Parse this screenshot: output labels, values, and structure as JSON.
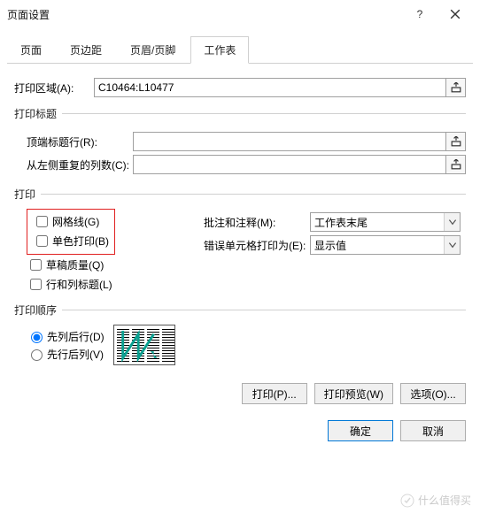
{
  "window": {
    "title": "页面设置"
  },
  "tabs": {
    "page": "页面",
    "margins": "页边距",
    "headerfooter": "页眉/页脚",
    "sheet": "工作表"
  },
  "printArea": {
    "label": "打印区域(A):",
    "value": "C10464:L10477"
  },
  "titles": {
    "legend": "打印标题",
    "topRows": {
      "label": "顶端标题行(R):",
      "value": ""
    },
    "leftCols": {
      "label": "从左侧重复的列数(C):",
      "value": ""
    }
  },
  "print": {
    "legend": "打印",
    "gridlines": "网格线(G)",
    "blackwhite": "单色打印(B)",
    "draft": "草稿质量(Q)",
    "rowcolhead": "行和列标题(L)",
    "commentsLabel": "批注和注释(M):",
    "commentsValue": "工作表末尾",
    "errorsLabel": "错误单元格打印为(E):",
    "errorsValue": "显示值"
  },
  "order": {
    "legend": "打印顺序",
    "downover": "先列后行(D)",
    "overdown": "先行后列(V)"
  },
  "buttons": {
    "print": "打印(P)...",
    "preview": "打印预览(W)",
    "options": "选项(O)...",
    "ok": "确定",
    "cancel": "取消"
  },
  "watermark": "什么值得买"
}
